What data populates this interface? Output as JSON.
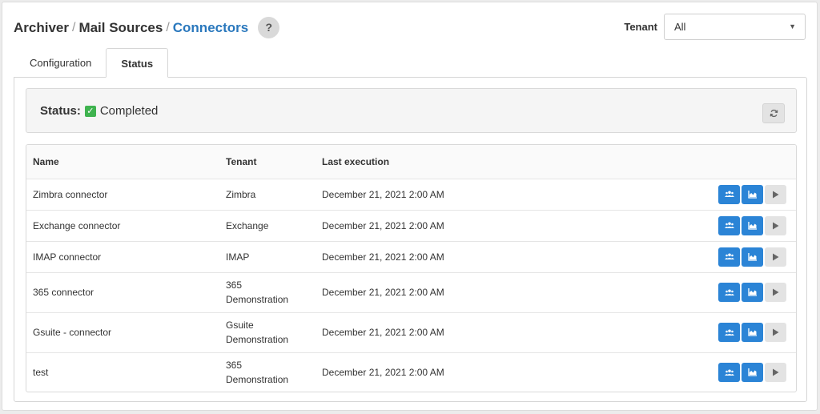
{
  "breadcrumb": {
    "items": [
      "Archiver",
      "Mail Sources"
    ],
    "current": "Connectors",
    "separator": "/"
  },
  "help": {
    "label": "?"
  },
  "tenant_filter": {
    "label": "Tenant",
    "selected": "All"
  },
  "tabs": [
    {
      "label": "Configuration",
      "active": false
    },
    {
      "label": "Status",
      "active": true
    }
  ],
  "status": {
    "label": "Status:",
    "value": "Completed"
  },
  "table": {
    "headers": {
      "name": "Name",
      "tenant": "Tenant",
      "last_execution": "Last execution"
    },
    "rows": [
      {
        "name": "Zimbra connector",
        "tenant": [
          "Zimbra"
        ],
        "last_execution": "December 21, 2021 2:00 AM"
      },
      {
        "name": "Exchange connector",
        "tenant": [
          "Exchange"
        ],
        "last_execution": "December 21, 2021 2:00 AM"
      },
      {
        "name": "IMAP connector",
        "tenant": [
          "IMAP"
        ],
        "last_execution": "December 21, 2021 2:00 AM"
      },
      {
        "name": "365 connector",
        "tenant": [
          "365",
          "Demonstration"
        ],
        "last_execution": "December 21, 2021 2:00 AM"
      },
      {
        "name": "Gsuite - connector",
        "tenant": [
          "Gsuite",
          "Demonstration"
        ],
        "last_execution": "December 21, 2021 2:00 AM"
      },
      {
        "name": "test",
        "tenant": [
          "365",
          "Demonstration"
        ],
        "last_execution": "December 21, 2021 2:00 AM"
      }
    ]
  },
  "icons": {
    "users": "users-icon",
    "chart": "chart-icon",
    "play": "play-icon",
    "refresh": "refresh-icon",
    "check": "check-icon",
    "caret": "caret-down-icon"
  },
  "colors": {
    "accent": "#2b84d6",
    "link": "#2a78bd",
    "success": "#3fb34f"
  }
}
